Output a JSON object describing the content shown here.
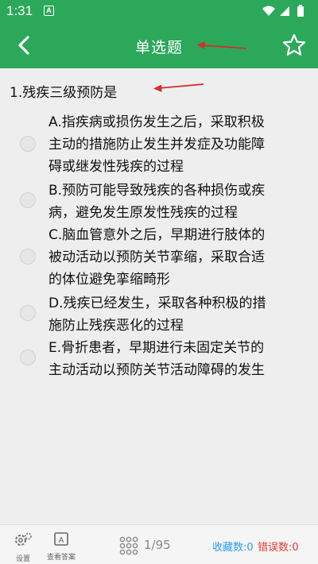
{
  "status_bar": {
    "time": "1:31",
    "notification_icon_text": "A"
  },
  "header": {
    "title": "单选题"
  },
  "question": {
    "text": "1.残疾三级预防是"
  },
  "options": [
    {
      "lines": [
        "A.指疾病或损伤发生之后，采取积极",
        "主动的措施防止发生并发症及功能障",
        "碍或继发性残疾的过程"
      ]
    },
    {
      "lines": [
        "B.预防可能导致残疾的各种损伤或疾",
        "病，避免发生原发性残疾的过程"
      ]
    },
    {
      "lines": [
        "C.脑血管意外之后，早期进行肢体的",
        "被动活动以预防关节挛缩，采取合适",
        "的体位避免挛缩畸形"
      ]
    },
    {
      "lines": [
        "D.残疾已经发生，采取各种积极的措",
        "施防止残疾恶化的过程"
      ]
    },
    {
      "lines": [
        "E.骨折患者，早期进行未固定关节的",
        "主动活动以预防关节活动障碍的发生"
      ]
    }
  ],
  "bottom_bar": {
    "settings_label": "设置",
    "view_answer_label": "查看答案",
    "progress": "1/95",
    "favorites": "收藏数:0",
    "errors": "错误数:0"
  },
  "colors": {
    "brand_green": "#2ca85a",
    "annotation_red": "#d32f2f",
    "favorites_blue": "#2a9df4",
    "errors_red": "#e53935"
  },
  "icons": [
    "back-arrow-icon",
    "star-icon",
    "gear-icon",
    "answer-sheet-icon",
    "grid-icon",
    "wifi-icon",
    "signal-icon",
    "battery-icon"
  ]
}
